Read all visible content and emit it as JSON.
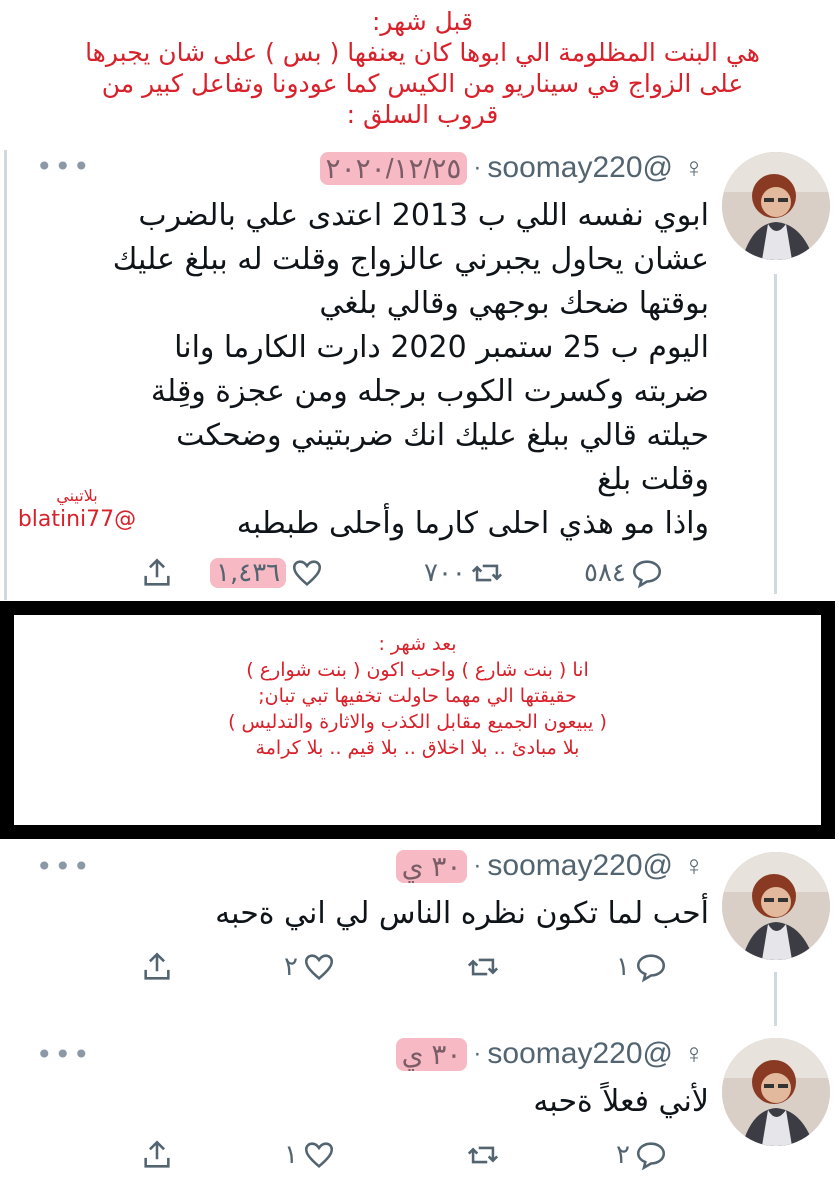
{
  "top_note": {
    "heading": "قبل شهر:",
    "lines": [
      "هي البنت المظلومة الي ابوها كان يعنفها ( بس ) على شان يجبرها",
      "على الزواج في سيناريو من الكيس كما عودونا وتفاعل كبير من",
      "قروب السلق :"
    ]
  },
  "tweet_main": {
    "handle": "@soomay220",
    "date": "٢٠٢٠/١٢/٢٥",
    "body": "ابوي نفسه اللي ب 2013 اعتدى علي بالضرب\nعشان يحاول يجبرني عالزواج وقلت له ببلغ عليك\nبوقتها ضحك بوجهي وقالي بلغي\nاليوم ب 25 ستمبر 2020 دارت الكارما وانا\nضربته وكسرت الكوب برجله ومن عجزة وقِلة\nحيلته قالي ببلغ عليك انك ضربتيني وضحكت\nوقلت بلغ\nواذا مو هذي احلى كارما وأحلى طبطبه",
    "replies": "٥٨٤",
    "retweets": "٧٠٠",
    "likes": "١,٤٣٦"
  },
  "watermark": {
    "name": "بلاتيني",
    "handle": "blatini77@"
  },
  "mid_box": {
    "heading": "بعد شهر :",
    "lines": [
      "انا ( بنت شارع ) واحب اكون ( بنت شوارع )",
      "حقيقتها الي مهما حاولت تخفيها تبي تبان;",
      "( يبيعون الجميع مقابل الكذب والاثارة والتدليس )",
      "بلا مبادئ .. بلا اخلاق .. بلا قيم .. بلا كرامة"
    ]
  },
  "tweet_2": {
    "handle": "@soomay220",
    "date": "٣٠ ي",
    "body": "أحب لما تكون نظره الناس لي اني ةحبه",
    "replies": "١",
    "likes": "٢"
  },
  "tweet_3": {
    "handle": "@soomay220",
    "date": "٣٠ ي",
    "body": "لأني فعلاً ةحبه",
    "replies": "٢",
    "likes": "١"
  },
  "icons": {
    "gender": "female-sign-icon",
    "more": "more-dots-icon",
    "reply": "reply-bubble-icon",
    "retweet": "retweet-icon",
    "like": "heart-icon",
    "share": "share-icon"
  },
  "colors": {
    "accent_red": "#d8212a",
    "muted_text": "#536471",
    "highlight_pink": "#f08296"
  }
}
